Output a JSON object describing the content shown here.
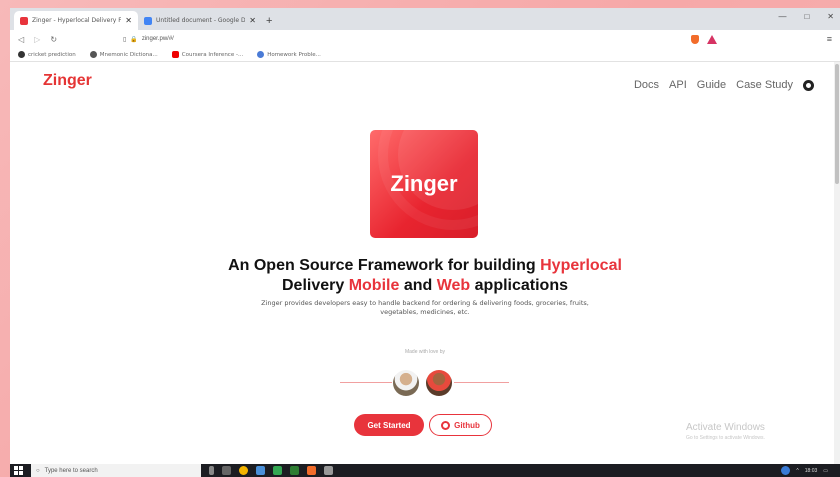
{
  "browser": {
    "tabs": [
      {
        "title": "Zinger - Hyperlocal Delivery Fram",
        "favicon_color": "#e8343c",
        "active": true
      },
      {
        "title": "Untitled document - Google Docs",
        "favicon_color": "#4285f4",
        "active": false
      }
    ],
    "url": "zinger.pw/#/",
    "bookmarks": [
      {
        "label": "cricket prediction",
        "icon": "github-icon"
      },
      {
        "label": "Mnemonic Dictiona...",
        "icon": "web-icon"
      },
      {
        "label": "Coursera Inference -...",
        "icon": "youtube-icon"
      },
      {
        "label": "Homework Proble...",
        "icon": "link-icon"
      }
    ]
  },
  "site": {
    "logo": "Zinger",
    "nav": [
      "Docs",
      "API",
      "Guide",
      "Case Study"
    ],
    "hero_logo_text": "Zinger",
    "headline_line1_prefix": "An Open Source Framework for building ",
    "headline_line1_highlight": "Hyperlocal",
    "headline_line2_a": "Delivery ",
    "headline_line2_b": "Mobile",
    "headline_line2_c": " and ",
    "headline_line2_d": "Web",
    "headline_line2_e": " applications",
    "subtitle": "Zinger provides developers easy to handle backend for ordering & delivering foods, groceries, fruits, vegetables, medicines, etc.",
    "made_with": "Made with love by",
    "primary_button": "Get Started",
    "secondary_button": "Github",
    "accent_color": "#e8343c"
  },
  "windows": {
    "activate_title": "Activate Windows",
    "activate_sub": "Go to Settings to activate Windows.",
    "search_placeholder": "Type here to search",
    "clock": "18:03"
  }
}
